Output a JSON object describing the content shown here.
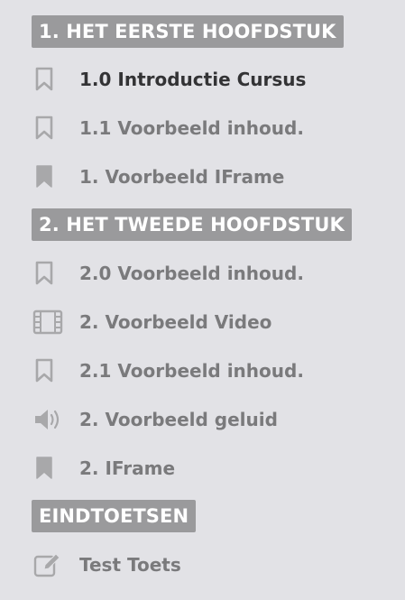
{
  "sections": [
    {
      "title": "1. HET EERSTE HOOFDSTUK",
      "items": [
        {
          "label": "1.0 Introductie Cursus",
          "icon": "bookmark-outline-icon"
        },
        {
          "label": "1.1 Voorbeeld inhoud.",
          "icon": "bookmark-outline-icon"
        },
        {
          "label": "1. Voorbeeld IFrame",
          "icon": "bookmark-filled-icon"
        }
      ]
    },
    {
      "title": "2. HET TWEEDE HOOFDSTUK",
      "items": [
        {
          "label": "2.0 Voorbeeld inhoud.",
          "icon": "bookmark-outline-icon"
        },
        {
          "label": "2. Voorbeeld Video",
          "icon": "film-icon"
        },
        {
          "label": "2.1 Voorbeeld inhoud.",
          "icon": "bookmark-outline-icon"
        },
        {
          "label": "2. Voorbeeld geluid",
          "icon": "volume-icon"
        },
        {
          "label": "2. IFrame",
          "icon": "bookmark-filled-icon"
        }
      ]
    },
    {
      "title": "EINDTOETSEN",
      "items": [
        {
          "label": "Test Toets",
          "icon": "edit-icon"
        }
      ]
    }
  ],
  "colors": {
    "background": "#e2e2e6",
    "chapter_bg": "#9a9a9c",
    "chapter_text": "#ffffff",
    "item_text": "#7a7a7c",
    "active_item_text": "#333335",
    "icon": "#a8a8aa"
  }
}
